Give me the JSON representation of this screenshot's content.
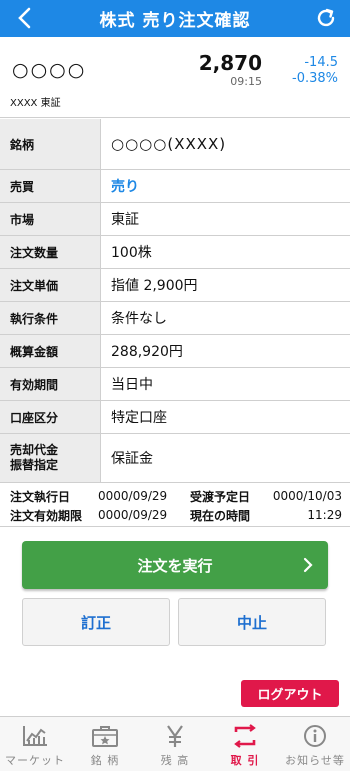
{
  "header": {
    "title": "株式 売り注文確認"
  },
  "stock": {
    "name": "○○○○",
    "code_market": "XXXX 東証",
    "price": "2,870",
    "time": "09:15",
    "change": "-14.5",
    "change_pct": "-0.38%"
  },
  "details": [
    {
      "label": "銘柄",
      "value": "○○○○(XXXX)"
    },
    {
      "label": "売買",
      "value": "売り"
    },
    {
      "label": "市場",
      "value": "東証"
    },
    {
      "label": "注文数量",
      "value": "100株"
    },
    {
      "label": "注文単価",
      "value": "指値 2,900円"
    },
    {
      "label": "執行条件",
      "value": "条件なし"
    },
    {
      "label": "概算金額",
      "value": "288,920円"
    },
    {
      "label": "有効期間",
      "value": "当日中"
    },
    {
      "label": "口座区分",
      "value": "特定口座"
    },
    {
      "label_line1": "売却代金",
      "label_line2": "振替指定",
      "value": "保証金"
    }
  ],
  "dates": {
    "exec_label": "注文執行日",
    "exec_value": "0000/09/29",
    "settle_label": "受渡予定日",
    "settle_value": "0000/10/03",
    "valid_label": "注文有効期限",
    "valid_value": "0000/09/29",
    "now_label": "現在の時間",
    "now_value": "11:29"
  },
  "buttons": {
    "execute": "注文を実行",
    "revise": "訂正",
    "cancel": "中止",
    "logout": "ログアウト"
  },
  "nav": [
    {
      "label": "マーケット",
      "icon": "chart-icon"
    },
    {
      "label": "銘 柄",
      "icon": "briefcase-icon"
    },
    {
      "label": "残 高",
      "icon": "yen-icon"
    },
    {
      "label": "取 引",
      "icon": "exchange-icon"
    },
    {
      "label": "お知らせ等",
      "icon": "info-icon"
    }
  ],
  "colors": {
    "header": "#1e88e5",
    "execute": "#43a047",
    "logout": "#e0184a",
    "accent_blue": "#1e88e5",
    "nav_active": "#e0184a"
  }
}
